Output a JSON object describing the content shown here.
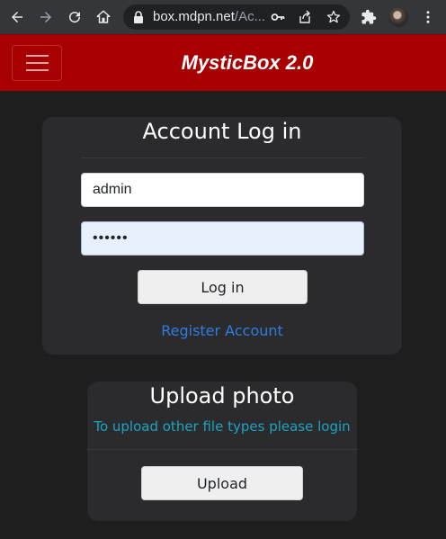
{
  "browser": {
    "url_host": "box.mdpn.net",
    "url_path": "/Ac..."
  },
  "navbar": {
    "brand": "MysticBox 2.0",
    "bg_color": "#a80000"
  },
  "login": {
    "title": "Account Log in",
    "username_value": "admin",
    "password_value": "••••••",
    "login_button": "Log in",
    "register_link": "Register Account"
  },
  "upload": {
    "title": "Upload photo",
    "info_text": "To upload other file types please login",
    "upload_button": "Upload"
  },
  "icons": [
    "back-icon",
    "forward-icon",
    "reload-icon",
    "home-icon",
    "lock-icon",
    "key-icon",
    "share-icon",
    "star-icon",
    "extensions-icon",
    "profile-avatar",
    "menu-icon",
    "hamburger-icon"
  ]
}
